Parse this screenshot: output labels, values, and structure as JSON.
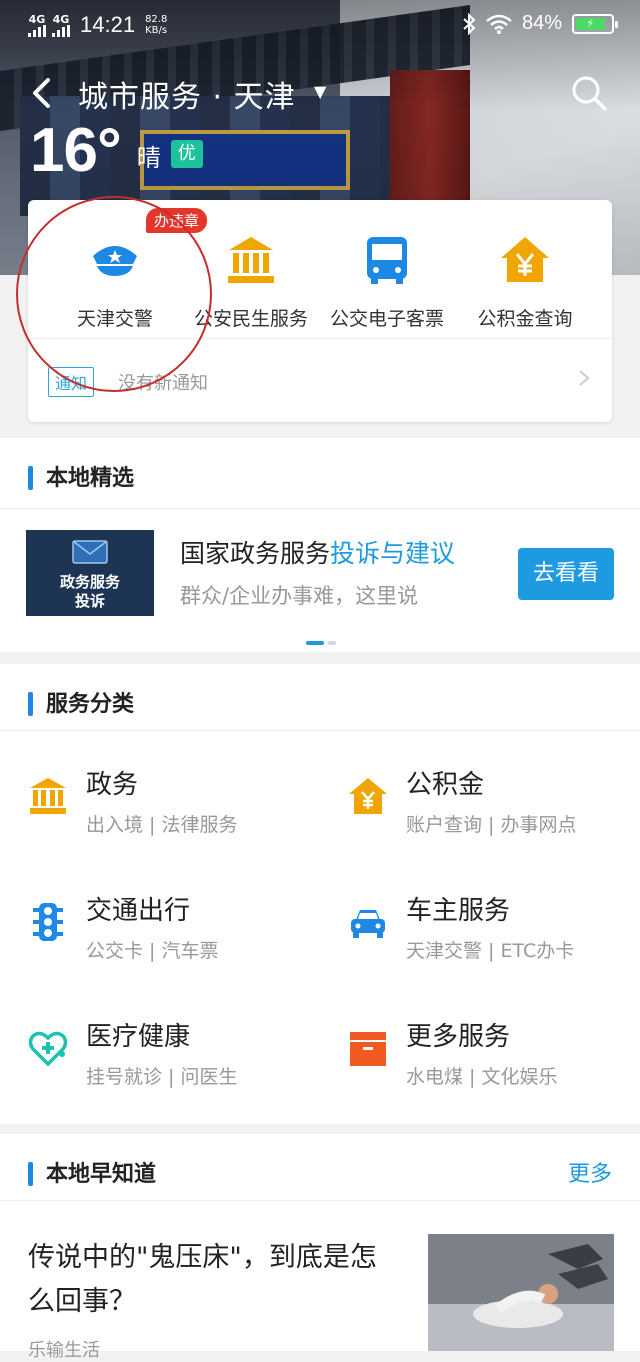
{
  "status_bar": {
    "network_1": "4G",
    "network_2": "4G",
    "time": "14:21",
    "speed_value": "82.8",
    "speed_unit": "KB/s",
    "battery_percent": "84%",
    "battery_level": 0.84
  },
  "header": {
    "title": "城市服务 · 天津",
    "temperature": "16°",
    "weather": "晴",
    "air_quality": "优",
    "colors": {
      "aqi_badge": "#1cc29b"
    }
  },
  "quick_services": {
    "badge": "办违章",
    "items": [
      {
        "label": "天津交警",
        "icon": "police-cap-icon"
      },
      {
        "label": "公安民生服务",
        "icon": "government-building-icon"
      },
      {
        "label": "公交电子客票",
        "icon": "bus-icon"
      },
      {
        "label": "公积金查询",
        "icon": "housing-fund-icon"
      }
    ],
    "notice": {
      "tag": "通知",
      "text": "没有新通知"
    }
  },
  "local_picks": {
    "title": "本地精选",
    "banner": {
      "image_text_1": "政务服务",
      "image_text_2": "投诉",
      "headline": "国家政务服务",
      "headline_highlight": "投诉与建议",
      "subtitle": "群众/企业办事难，这里说",
      "button": "去看看"
    }
  },
  "service_categories": {
    "title": "服务分类",
    "items": [
      {
        "name": "政务",
        "desc": "出入境 | 法律服务",
        "icon": "government-building-icon"
      },
      {
        "name": "公积金",
        "desc": "账户查询 | 办事网点",
        "icon": "housing-fund-icon"
      },
      {
        "name": "交通出行",
        "desc": "公交卡 | 汽车票",
        "icon": "traffic-light-icon"
      },
      {
        "name": "车主服务",
        "desc": "天津交警 | ETC办卡",
        "icon": "car-icon"
      },
      {
        "name": "医疗健康",
        "desc": "挂号就诊 | 问医生",
        "icon": "medical-heart-icon"
      },
      {
        "name": "更多服务",
        "desc": "水电煤 | 文化娱乐",
        "icon": "box-icon"
      }
    ]
  },
  "local_news": {
    "title": "本地早知道",
    "more": "更多",
    "article": {
      "title": "传说中的\"鬼压床\"，到底是怎么回事？",
      "source": "乐输生活"
    }
  },
  "colors": {
    "accent": "#1e9be0",
    "gold_icon": "#f0a500",
    "badge_red": "#e5362c"
  }
}
